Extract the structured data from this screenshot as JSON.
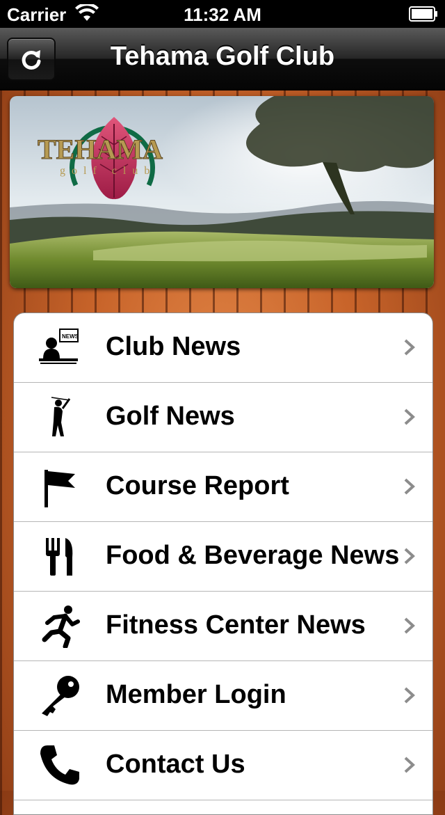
{
  "status_bar": {
    "carrier": "Carrier",
    "time": "11:32 AM"
  },
  "nav": {
    "title": "Tehama Golf Club",
    "refresh_icon": "refresh-icon"
  },
  "banner": {
    "logo_text": "TEHAMA",
    "logo_subtext": "golf club"
  },
  "menu": {
    "items": [
      {
        "label": "Club News",
        "icon": "newspaper-reader-icon"
      },
      {
        "label": "Golf News",
        "icon": "golfer-icon"
      },
      {
        "label": "Course Report",
        "icon": "flag-icon"
      },
      {
        "label": "Food & Beverage News",
        "icon": "fork-knife-icon"
      },
      {
        "label": "Fitness Center News",
        "icon": "runner-icon"
      },
      {
        "label": "Member Login",
        "icon": "key-icon"
      },
      {
        "label": "Contact Us",
        "icon": "phone-icon"
      }
    ]
  },
  "colors": {
    "nav_bar": "#1a1a1a",
    "wood": "#c8642a",
    "menu_bg": "#ffffff",
    "chevron": "#8c8c8c"
  }
}
